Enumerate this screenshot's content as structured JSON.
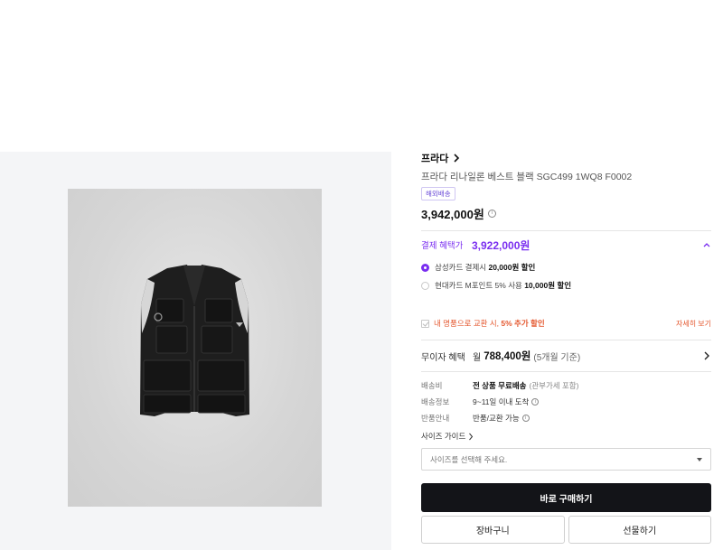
{
  "brand": {
    "name": "프라다"
  },
  "product": {
    "name": "프라다 리나일론 베스트 블랙 SGC499 1WQ8 F0002",
    "badge": "해외배송",
    "price": "3,942,000원"
  },
  "benefits": {
    "label": "결제 혜택가",
    "price": "3,922,000원",
    "options": [
      {
        "prefix": "삼성카드 결제시 ",
        "bold": "20,000원 할인",
        "selected": true
      },
      {
        "prefix": "현대카드 M포인트 5% 사용 ",
        "bold": "10,000원 할인",
        "selected": false
      }
    ]
  },
  "trade_in": {
    "text": "내 명품으로 교환 시, ",
    "bold": "5% 추가 할인",
    "detail_link": "자세히 보기"
  },
  "installment": {
    "label": "무이자 혜택",
    "prefix": "월",
    "amount": "788,400원",
    "suffix": "(5개월 기준)"
  },
  "specs": [
    {
      "key": "배송비",
      "bold": "전 상품 무료배송",
      "gray": "(관부가세 포함)",
      "info": false
    },
    {
      "key": "배송정보",
      "bold": "",
      "gray": "9~11일 이내 도착",
      "info": true
    },
    {
      "key": "반품안내",
      "bold": "",
      "gray": "반품/교환 가능",
      "info": true
    }
  ],
  "size_guide": {
    "label": "사이즈 가이드"
  },
  "size_select": {
    "placeholder": "사이즈를 선택해 주세요."
  },
  "actions": {
    "buy_now": "바로 구매하기",
    "cart": "장바구니",
    "gift": "선물하기"
  },
  "colors": {
    "accent": "#7a2ef0",
    "highlight": "#e4572e",
    "primary_button": "#131418",
    "gallery_bg": "#f4f5f7"
  },
  "icons": [
    "chevron-right-icon",
    "info-icon",
    "chevron-up-icon",
    "checkbox-icon",
    "caret-down-icon"
  ]
}
